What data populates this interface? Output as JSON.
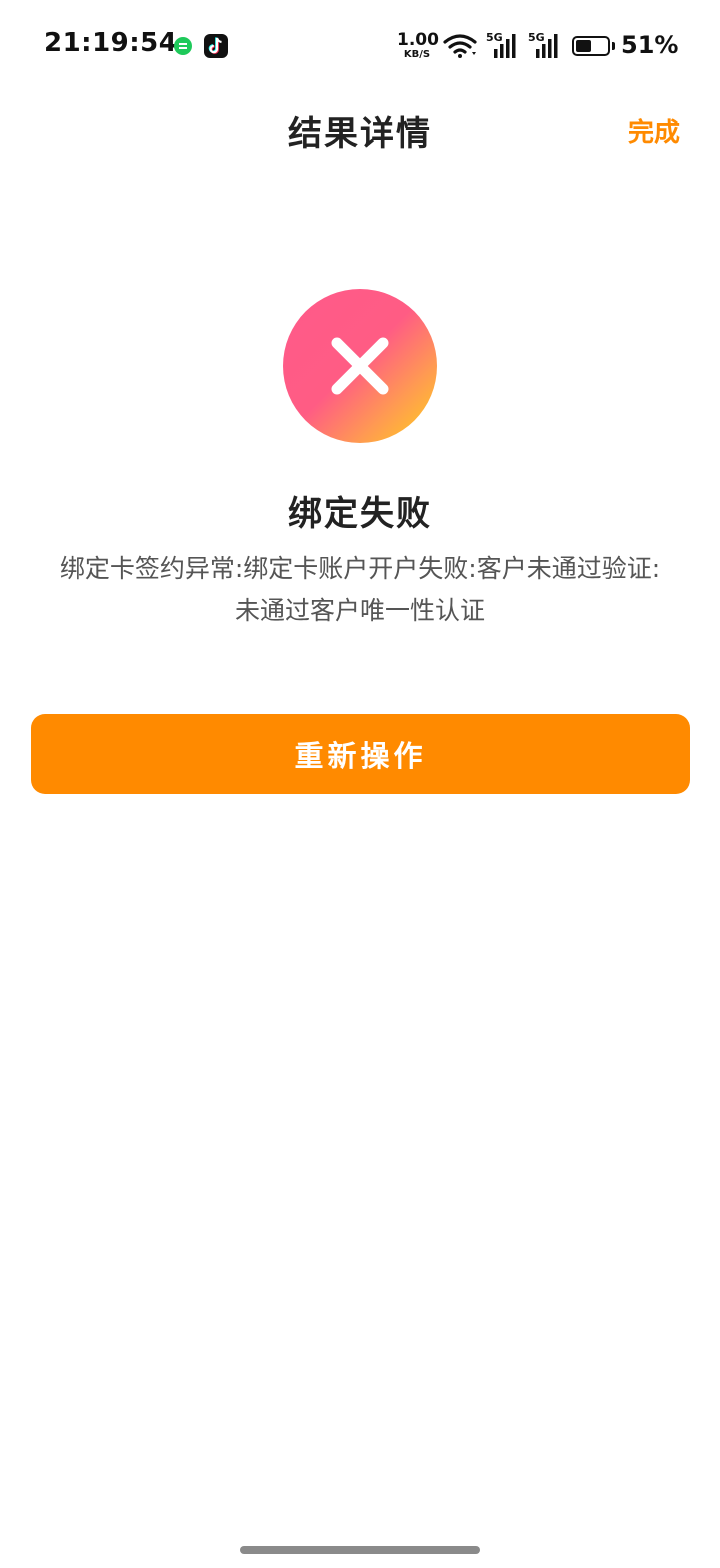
{
  "status_bar": {
    "time": "21:19:54",
    "net_speed_value": "1.00",
    "net_speed_unit": "KB/S",
    "sim1_label": "5G",
    "sim2_label": "5G",
    "battery_percent": "51%",
    "battery_level": 0.51,
    "icons": [
      "chat-notification-icon",
      "tiktok-icon",
      "wifi-icon",
      "signal-icon",
      "signal-icon",
      "battery-icon"
    ]
  },
  "nav": {
    "title": "结果详情",
    "done_label": "完成"
  },
  "result": {
    "icon": "close-icon",
    "title": "绑定失败",
    "description_line1": "绑定卡签约异常:绑定卡账户开户失败:客户未通过验证:",
    "description_line2": "未通过客户唯一性认证"
  },
  "actions": {
    "retry_label": "重新操作"
  },
  "colors": {
    "accent": "#ff8a00",
    "error_gradient_start": "#ff5a8a",
    "error_gradient_end": "#ffd21a"
  }
}
